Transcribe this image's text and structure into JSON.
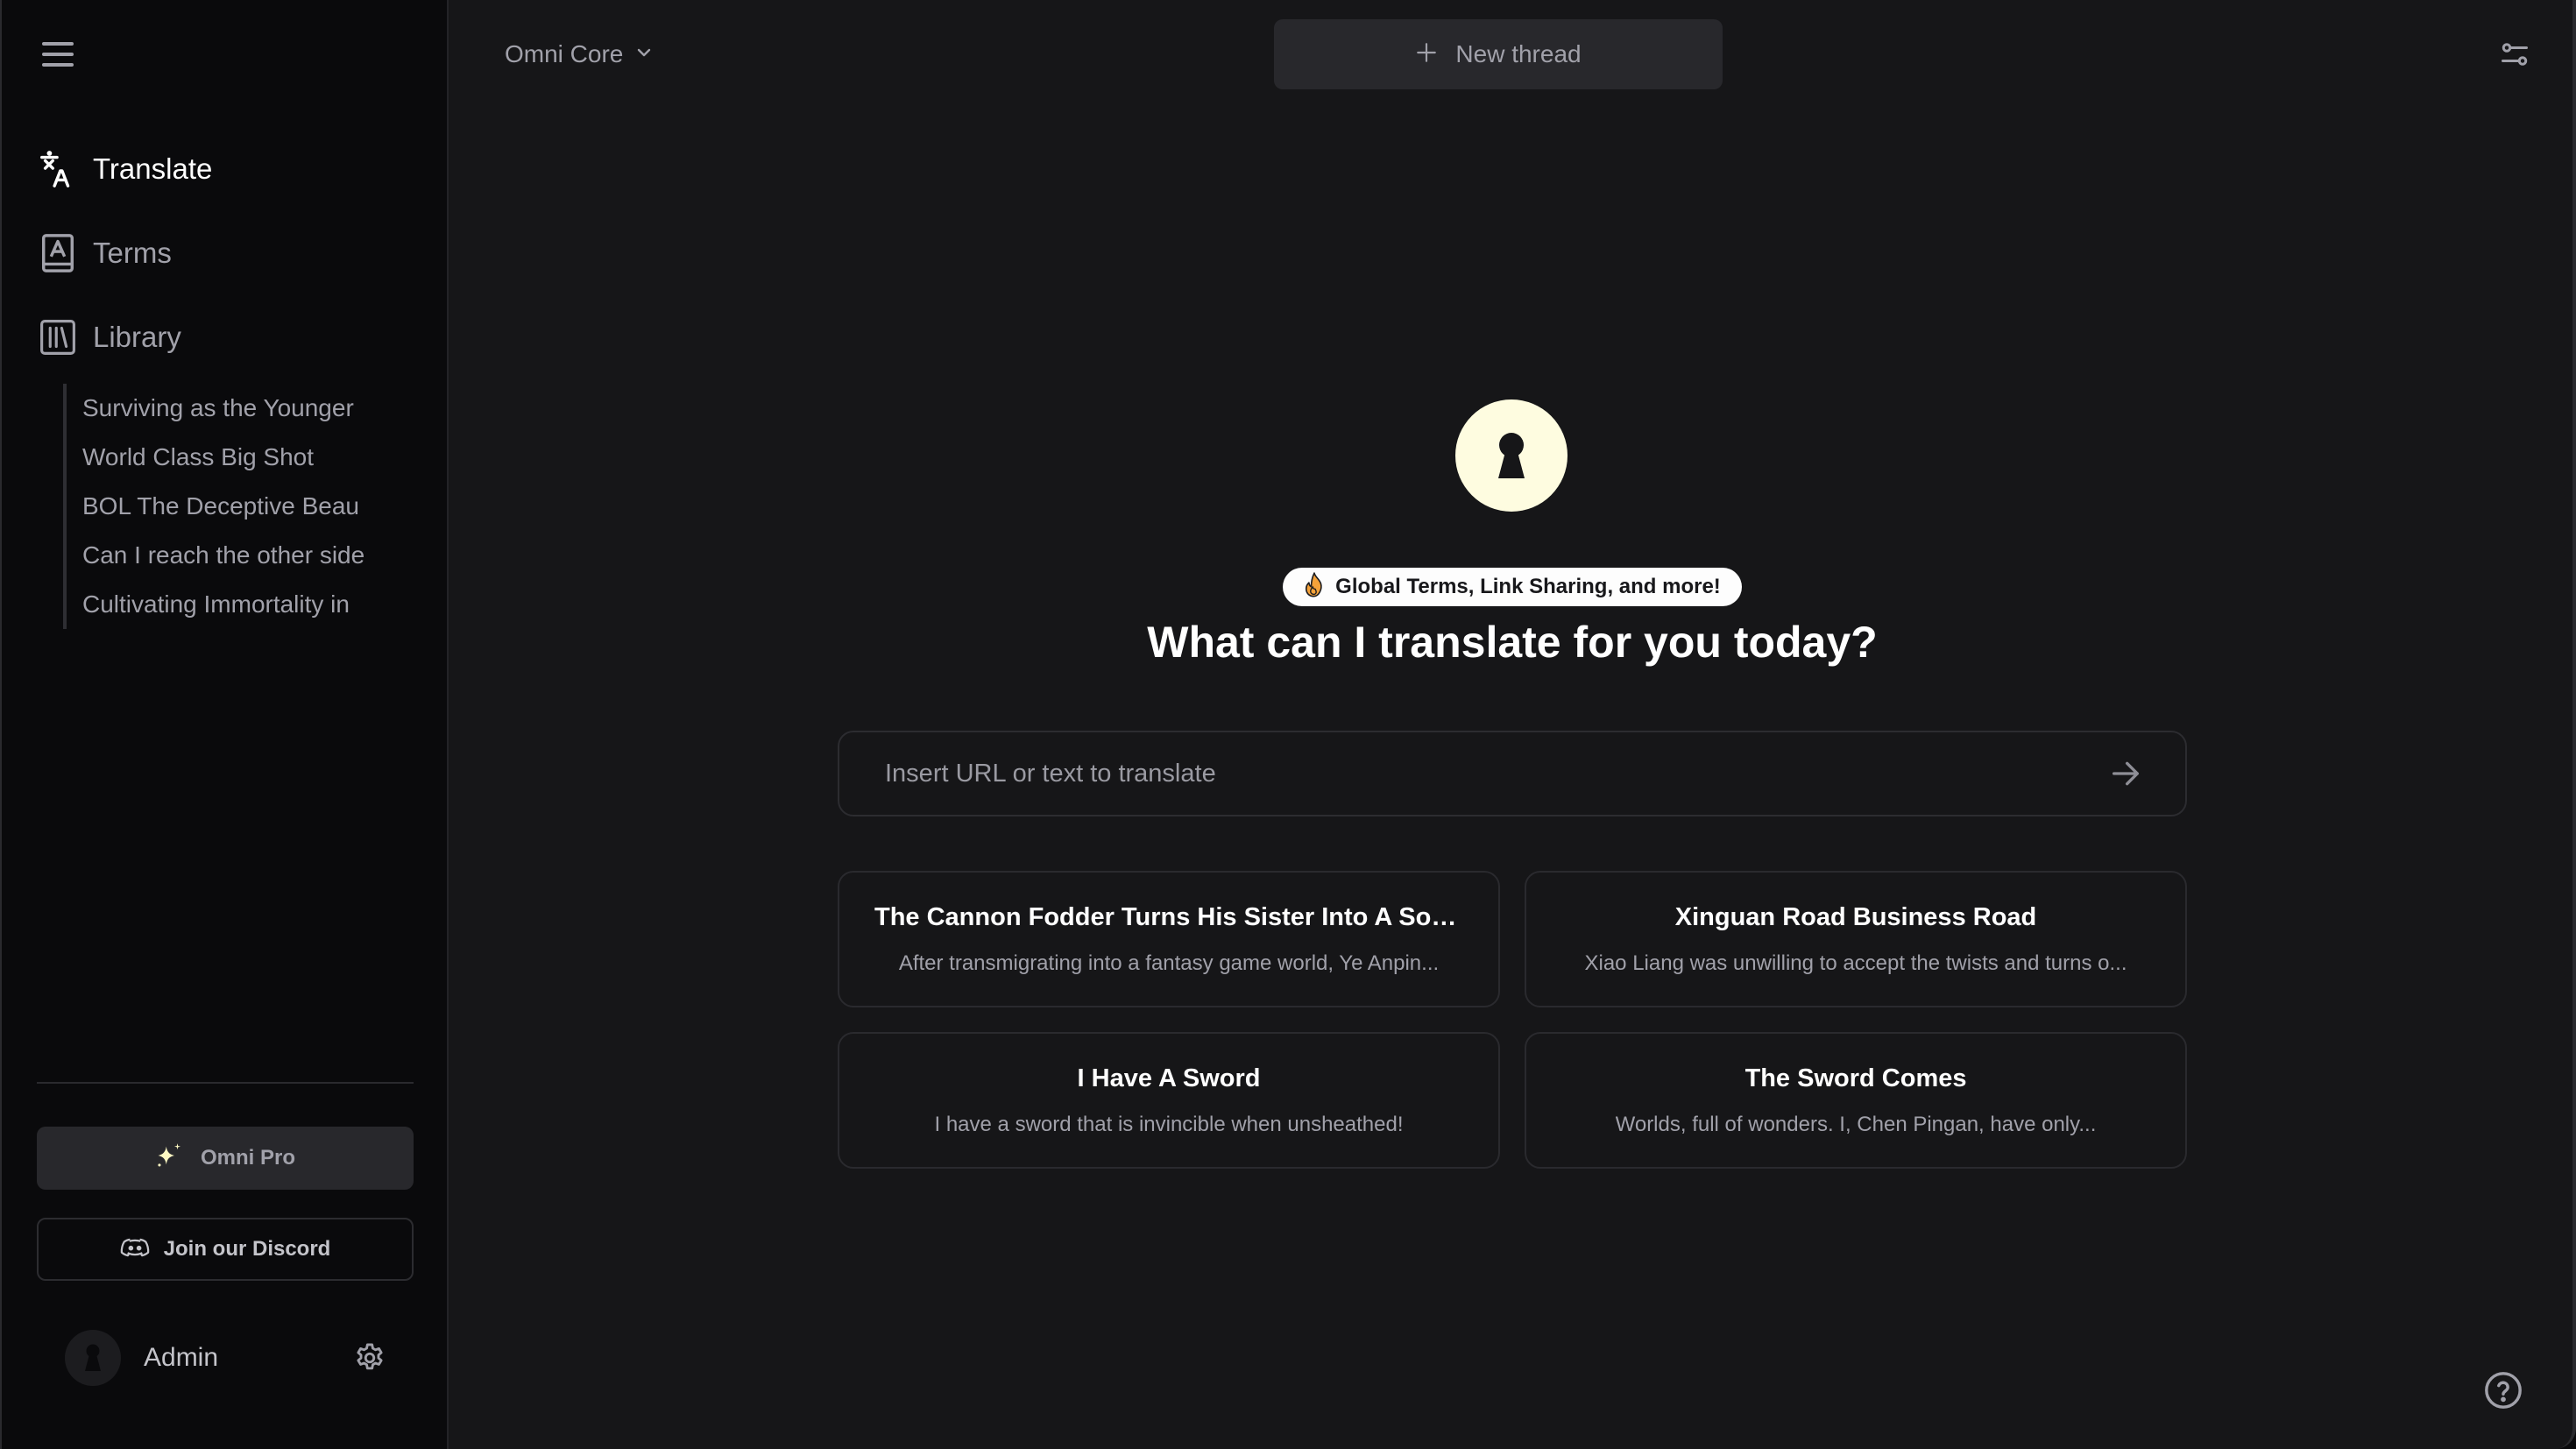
{
  "sidebar": {
    "menu_icon": "hamburger-menu-icon",
    "nav": [
      {
        "label": "Translate",
        "icon": "translate-icon",
        "active": true
      },
      {
        "label": "Terms",
        "icon": "book-glossary-icon",
        "active": false
      },
      {
        "label": "Library",
        "icon": "library-icon",
        "active": false
      }
    ],
    "library_items": [
      "Surviving as the Younger",
      "World Class Big Shot",
      "BOL The Deceptive Beau",
      "Can I reach the other side",
      "Cultivating Immortality in"
    ],
    "pro_button": {
      "label": "Omni Pro",
      "icon": "sparkles-icon",
      "icon_color": "#fef9c3"
    },
    "discord_button": {
      "label": "Join our Discord",
      "icon": "discord-icon"
    },
    "user": {
      "name": "Admin",
      "avatar_icon": "keyhole-icon",
      "settings_icon": "gear-icon"
    }
  },
  "header": {
    "model_selector": {
      "label": "Omni Core",
      "icon": "chevron-down-icon"
    },
    "new_thread": {
      "label": "New thread",
      "icon": "plus-icon"
    },
    "filters_icon": "sliders-icon"
  },
  "hero": {
    "logo_icon": "keyhole-icon",
    "logo_color": "#fefce0",
    "badge": {
      "emoji": "🔥",
      "label": "Global Terms, Link Sharing, and more!"
    },
    "title": "What can I translate for you today?"
  },
  "input": {
    "placeholder": "Insert URL or text to translate",
    "value": "",
    "submit_icon": "arrow-right-icon"
  },
  "suggestions": [
    {
      "title": "The Cannon Fodder Turns His Sister Into A Soari...",
      "description": "After transmigrating into a fantasy game world, Ye Anpin..."
    },
    {
      "title": "Xinguan Road Business Road",
      "description": "Xiao Liang was unwilling to accept the twists and turns o..."
    },
    {
      "title": "I Have A Sword",
      "description": "I have a sword that is invincible when unsheathed!"
    },
    {
      "title": "The Sword Comes",
      "description": "Worlds, full of wonders. I, Chen Pingan, have only..."
    }
  ],
  "help_icon": "help-circle-icon"
}
